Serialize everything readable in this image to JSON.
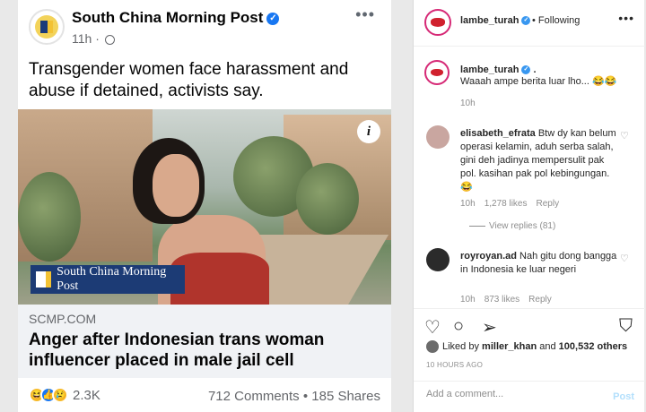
{
  "facebook": {
    "page_name": "South China Morning Post",
    "time": "11h ·",
    "caption": "Transgender women face harassment and abuse if detained, activists say.",
    "image_badge": "South China Morning Post",
    "link_domain": "SCMP.COM",
    "link_headline": "Anger after Indonesian trans woman influencer placed in male jail cell",
    "reaction_count": "2.3K",
    "stats": "712 Comments • 185 Shares",
    "reactions": [
      "haha",
      "like",
      "sad"
    ]
  },
  "instagram": {
    "header": {
      "username": "lambe_turah",
      "following": "• Following"
    },
    "post_caption": {
      "username": "lambe_turah",
      "suffix": ".",
      "text": "Waaah ampe berita luar lho... 😂😂",
      "time": "10h"
    },
    "comments": [
      {
        "username": "elisabeth_efrata",
        "text": "Btw dy kan belum operasi kelamin, aduh serba salah, gini deh jadinya mempersulit pak pol. kasihan pak pol kebingungan. 😂",
        "time": "10h",
        "likes": "1,278 likes",
        "reply": "Reply",
        "view_replies": "View replies (81)"
      },
      {
        "username": "royroyan.ad",
        "text": "Nah gitu dong bangga in Indonesia ke luar negeri",
        "time": "10h",
        "likes": "873 likes",
        "reply": "Reply"
      }
    ],
    "liked_by_prefix": "Liked by",
    "liked_by_user": "miller_khan",
    "liked_by_and": "and",
    "liked_by_count": "100,532 others",
    "timestamp": "10 HOURS AGO",
    "comment_placeholder": "Add a comment...",
    "post_label": "Post"
  },
  "colors": {
    "fb_blue": "#1877f2",
    "scmp_navy": "#1c3b75",
    "scmp_yellow": "#f3c233",
    "ig_link_disabled": "#b2dffc"
  }
}
